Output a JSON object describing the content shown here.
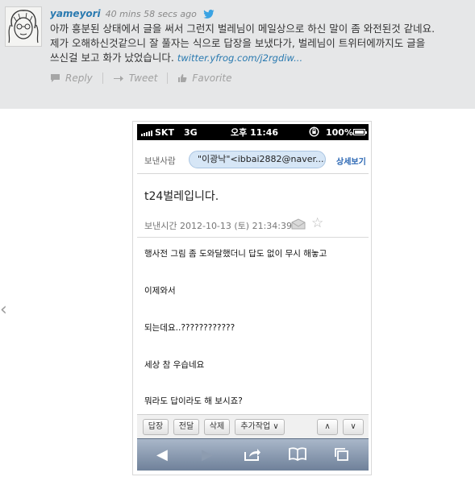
{
  "tweet": {
    "username": "yameyori",
    "timestamp": "40 mins 58 secs ago",
    "text_line1": "아까 흥분된 상태에서 글을 써서 그런지 벌레님이 메일상으로 하신 말이 좀 와전된것 같네요.",
    "text_line2": "제가 오해하신것같으니 잘 풀자는 식으로 답장을 보냈다가, 벌레님이 트위터에까지도 글을",
    "text_line3": "쓰신걸 보고 화가 났었습니다.",
    "link": "twitter.yfrog.com/j2rgdiw...",
    "actions": {
      "reply": "Reply",
      "retweet": "Tweet",
      "favorite": "Favorite"
    }
  },
  "phone": {
    "status": {
      "carrier": "SKT",
      "network": "3G",
      "time": "오후 11:46",
      "battery": "100%"
    },
    "email": {
      "from_label": "보낸사람",
      "sender": "\"이광낙\"<ibbai2882@naver....",
      "detail_button": "상세보기",
      "subject": "t24벌레입니다.",
      "sent_time": "보낸시간 2012-10-13 (토) 21:34:39",
      "body": [
        "행사전 그림 좀 도와달했더니 답도 없이 무시 해놓고",
        "이제와서",
        "되는데요..????????????",
        "세상 참 우습네요",
        "뭐라도 답이라도 해 보시죠?"
      ]
    },
    "toolbar": {
      "reply": "답장",
      "forward": "전달",
      "delete": "삭제",
      "more": "추가작업 ∨",
      "prev": "∧",
      "next": "∨"
    }
  },
  "icons": [
    "twitter-bird-icon",
    "reply-icon",
    "retweet-icon",
    "favorite-icon",
    "left-chevron-icon",
    "envelope-icon",
    "star-icon",
    "back-icon",
    "forward-icon",
    "share-icon",
    "bookmarks-icon",
    "tabs-icon"
  ],
  "colors": {
    "link": "#2a7ab0",
    "tweet_bg": "#e6e7e8",
    "chip_bg": "#d6e6f6",
    "navbar": "#8898ae"
  }
}
